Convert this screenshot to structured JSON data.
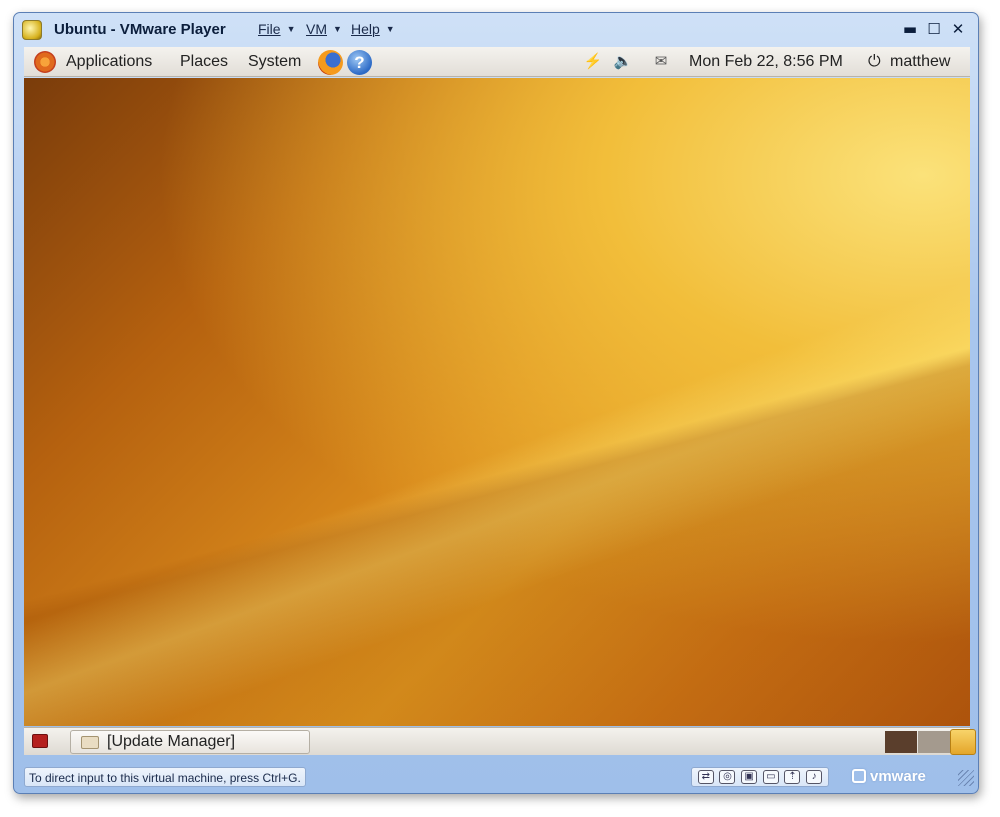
{
  "window": {
    "title": "Ubuntu - VMware Player",
    "menus": [
      {
        "label": "File"
      },
      {
        "label": "VM"
      },
      {
        "label": "Help"
      }
    ],
    "controls": {
      "minimize": "minimize-icon",
      "maximize": "maximize-icon",
      "close": "close-icon"
    }
  },
  "top_panel": {
    "menus": [
      "Applications",
      "Places",
      "System"
    ],
    "launchers": [
      "firefox-icon",
      "help-icon"
    ],
    "tray_icons": [
      "network-icon",
      "volume-icon",
      "mail-icon"
    ],
    "clock": "Mon Feb 22,  8:56 PM",
    "user": "matthew"
  },
  "bottom_panel": {
    "task": "[Update Manager]",
    "workspace_colors": [
      "#5a3e2c",
      "#a49a8e"
    ],
    "trash": "trash-icon"
  },
  "status_bar": {
    "message": "To direct input to this virtual machine, press Ctrl+G.",
    "device_icons": [
      "network-adapter-icon",
      "cd-drive-icon",
      "floppy-icon",
      "hard-disk-icon",
      "usb-device-icon",
      "sound-card-icon"
    ],
    "brand": "vmware"
  }
}
